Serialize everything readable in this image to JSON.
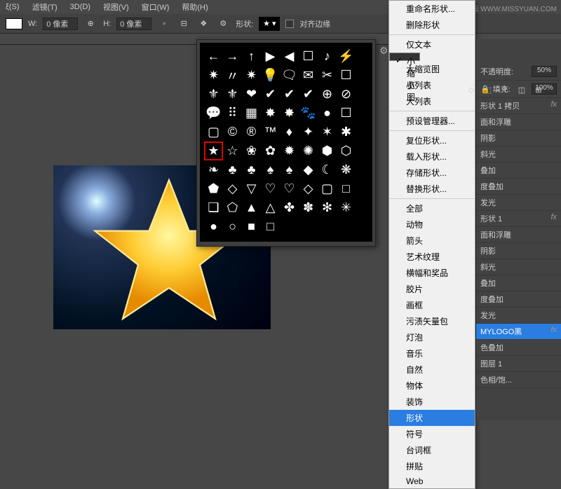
{
  "watermark": "思缘设计论坛  WWW.MISSYUAN.COM",
  "menubar": [
    "ξ(S)",
    "滤镜(T)",
    "3D(D)",
    "视图(V)",
    "窗口(W)",
    "帮助(H)"
  ],
  "optbar": {
    "w_label": "W:",
    "w_value": "0 像素",
    "h_label": "H:",
    "h_value": "0 像素",
    "link": "⊕",
    "shape_label": "形状:",
    "align_label": "对齐边缘"
  },
  "shape_grid": [
    [
      "←",
      "→",
      "↑",
      "▶",
      "◀",
      "☐",
      "♪",
      "⚡"
    ],
    [
      "✷",
      "〃",
      "✷",
      "💡",
      "🗨",
      "✉",
      "✂",
      "☐"
    ],
    [
      "⚜",
      "⚜",
      "❤",
      "✔",
      "✔",
      "✔",
      "⊕",
      "⊘"
    ],
    [
      "💬",
      "⠿",
      "▦",
      "✸",
      "✸",
      "🐾",
      "●",
      "☐"
    ],
    [
      "▢",
      "©",
      "®",
      "™",
      "♦",
      "✦",
      "✶",
      "✱"
    ],
    [
      "★",
      "☆",
      "❀",
      "✿",
      "✹",
      "✺",
      "⬢",
      "⬡"
    ],
    [
      "❧",
      "♣",
      "♣",
      "♠",
      "♠",
      "◆",
      "☾",
      "❋"
    ],
    [
      "⬟",
      "◇",
      "▽",
      "♡",
      "♡",
      "◇",
      "▢",
      "□"
    ],
    [
      "❑",
      "⬠",
      "▲",
      "△",
      "✤",
      "✽",
      "✻",
      "✳"
    ],
    [
      "●",
      "○",
      "■",
      "□",
      "",
      "",
      "",
      ""
    ]
  ],
  "selected_cell": [
    5,
    0
  ],
  "ctxmenu": {
    "items": [
      {
        "t": "重命名形状..."
      },
      {
        "t": "删除形状"
      },
      {
        "sep": 1
      },
      {
        "t": "仅文本"
      },
      {
        "t": "✓ 小缩览图",
        "chk": 1
      },
      {
        "t": "大缩览图"
      },
      {
        "t": "小列表"
      },
      {
        "t": "大列表"
      },
      {
        "sep": 1
      },
      {
        "t": "预设管理器..."
      },
      {
        "sep": 1
      },
      {
        "t": "复位形状..."
      },
      {
        "t": "载入形状..."
      },
      {
        "t": "存储形状..."
      },
      {
        "t": "替换形状..."
      },
      {
        "sep": 1
      },
      {
        "t": "全部"
      },
      {
        "t": "动物"
      },
      {
        "t": "箭头"
      },
      {
        "t": "艺术纹理"
      },
      {
        "t": "横幅和奖品"
      },
      {
        "t": "胶片"
      },
      {
        "t": "画框"
      },
      {
        "t": "污渍矢量包"
      },
      {
        "t": "灯泡"
      },
      {
        "t": "音乐"
      },
      {
        "t": "自然"
      },
      {
        "t": "物体"
      },
      {
        "t": "装饰"
      },
      {
        "t": "形状",
        "sel": 1
      },
      {
        "t": "符号"
      },
      {
        "t": "台词框"
      },
      {
        "t": "拼贴"
      },
      {
        "t": "Web"
      }
    ]
  },
  "rightpanel": {
    "toolbar_icons": [
      "◇",
      "⬚",
      "T",
      "◫",
      "⊞"
    ],
    "opacity_label": "不透明度:",
    "opacity_value": "50%",
    "fill_label": "填充:",
    "fill_value": "100%",
    "lock_icon": "🔒",
    "layers": [
      {
        "name": "形状 1 拷贝",
        "fx": "fx"
      },
      {
        "name": "面和浮雕"
      },
      {
        "name": "阴影"
      },
      {
        "name": "斜光"
      },
      {
        "name": "叠加"
      },
      {
        "name": "度叠加"
      },
      {
        "name": "发光"
      },
      {
        "name": "形状 1",
        "fx": "fx"
      },
      {
        "name": "面和浮雕"
      },
      {
        "name": "阴影"
      },
      {
        "name": "斜光"
      },
      {
        "name": "叠加"
      },
      {
        "name": "度叠加"
      },
      {
        "name": "发光"
      },
      {
        "name": "MYLOGO黑",
        "sel": 1,
        "fx": "fx"
      },
      {
        "name": "色叠加"
      },
      {
        "name": "图层 1"
      },
      {
        "name": "色相/饱..."
      }
    ]
  }
}
